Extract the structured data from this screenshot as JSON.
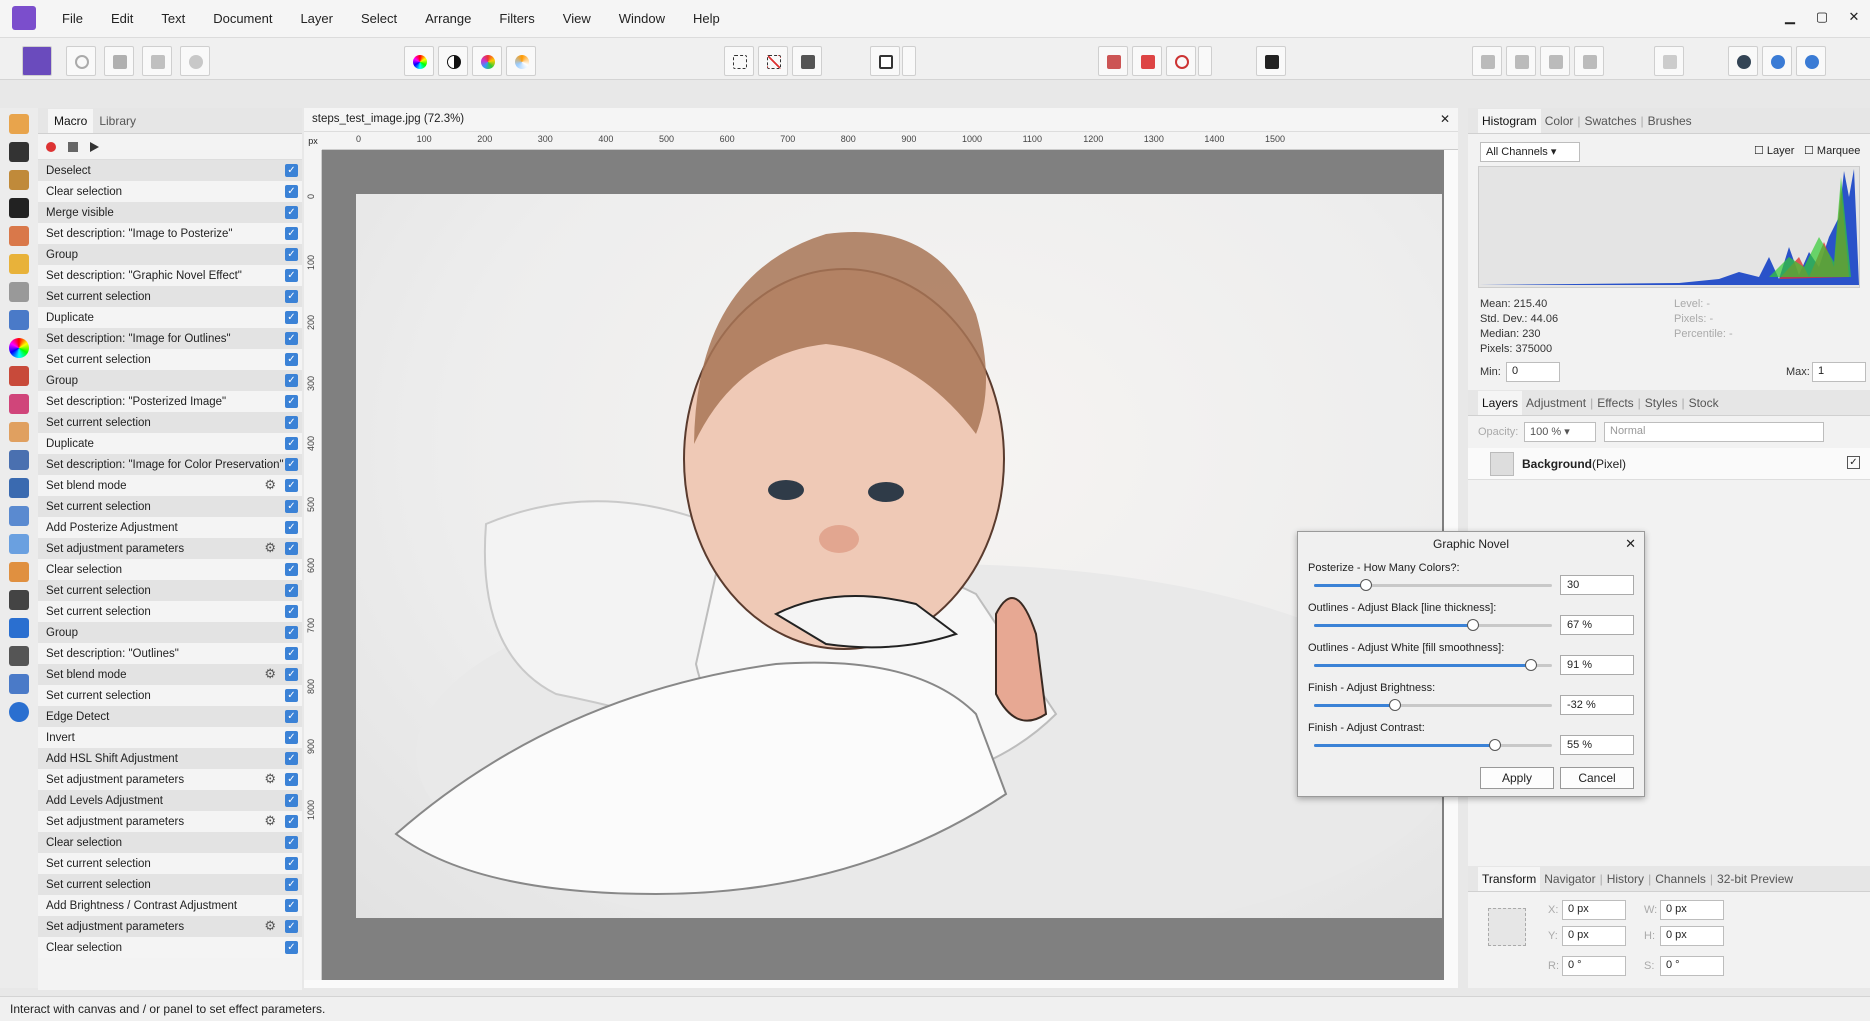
{
  "menu": [
    "File",
    "Edit",
    "Text",
    "Document",
    "Layer",
    "Select",
    "Arrange",
    "Filters",
    "View",
    "Window",
    "Help"
  ],
  "window_controls": {
    "minimize": "▁",
    "maximize": "▢",
    "close": "✕"
  },
  "macro_panel": {
    "tabs": [
      "Macro",
      "Library"
    ],
    "items": [
      {
        "label": "Deselect",
        "gear": false
      },
      {
        "label": "Clear selection",
        "gear": false
      },
      {
        "label": "Merge visible",
        "gear": false
      },
      {
        "label": "Set description: \"Image to Posterize\"",
        "gear": false
      },
      {
        "label": "Group",
        "gear": false
      },
      {
        "label": "Set description: \"Graphic Novel Effect\"",
        "gear": false
      },
      {
        "label": "Set current selection",
        "gear": false
      },
      {
        "label": "Duplicate",
        "gear": false
      },
      {
        "label": "Set description: \"Image for Outlines\"",
        "gear": false
      },
      {
        "label": "Set current selection",
        "gear": false
      },
      {
        "label": "Group",
        "gear": false
      },
      {
        "label": "Set description: \"Posterized Image\"",
        "gear": false
      },
      {
        "label": "Set current selection",
        "gear": false
      },
      {
        "label": "Duplicate",
        "gear": false
      },
      {
        "label": "Set description: \"Image for Color Preservation\"",
        "gear": false
      },
      {
        "label": "Set blend mode",
        "gear": true
      },
      {
        "label": "Set current selection",
        "gear": false
      },
      {
        "label": "Add Posterize Adjustment",
        "gear": false
      },
      {
        "label": "Set adjustment parameters",
        "gear": true
      },
      {
        "label": "Clear selection",
        "gear": false
      },
      {
        "label": "Set current selection",
        "gear": false
      },
      {
        "label": "Set current selection",
        "gear": false
      },
      {
        "label": "Group",
        "gear": false
      },
      {
        "label": "Set description: \"Outlines\"",
        "gear": false
      },
      {
        "label": "Set blend mode",
        "gear": true
      },
      {
        "label": "Set current selection",
        "gear": false
      },
      {
        "label": "Edge Detect",
        "gear": false
      },
      {
        "label": "Invert",
        "gear": false
      },
      {
        "label": "Add HSL Shift Adjustment",
        "gear": false
      },
      {
        "label": "Set adjustment parameters",
        "gear": true
      },
      {
        "label": "Add Levels Adjustment",
        "gear": false
      },
      {
        "label": "Set adjustment parameters",
        "gear": true
      },
      {
        "label": "Clear selection",
        "gear": false
      },
      {
        "label": "Set current selection",
        "gear": false
      },
      {
        "label": "Set current selection",
        "gear": false
      },
      {
        "label": "Add Brightness / Contrast Adjustment",
        "gear": false
      },
      {
        "label": "Set adjustment parameters",
        "gear": true
      },
      {
        "label": "Clear selection",
        "gear": false
      }
    ]
  },
  "document": {
    "tab_title": "steps_test_image.jpg (72.3%)",
    "close": "✕",
    "ruler_unit": "px",
    "h_ticks": [
      "0",
      "100",
      "200",
      "300",
      "400",
      "500",
      "600",
      "700",
      "800",
      "900",
      "1000",
      "1100",
      "1200",
      "1300",
      "1400",
      "1500"
    ],
    "v_ticks": [
      "0",
      "100",
      "200",
      "300",
      "400",
      "500",
      "600",
      "700",
      "800",
      "900",
      "1000"
    ]
  },
  "histogram": {
    "tabs": [
      "Histogram",
      "Color",
      "Swatches",
      "Brushes"
    ],
    "channel": "All Channels",
    "layer_label": "Layer",
    "marquee_label": "Marquee",
    "mean": "Mean: 215.40",
    "std": "Std. Dev.: 44.06",
    "median": "Median: 230",
    "pixels": "Pixels: 375000",
    "level": "Level: -",
    "pixels2": "Pixels: -",
    "percentile": "Percentile: -",
    "min_label": "Min:",
    "min": "0",
    "max_label": "Max:",
    "max": "1"
  },
  "layers": {
    "tabs": [
      "Layers",
      "Adjustment",
      "Effects",
      "Styles",
      "Stock"
    ],
    "opacity_label": "Opacity:",
    "opacity": "100 %",
    "blend": "Normal",
    "layer_name": "Background",
    "layer_type": "(Pixel)"
  },
  "transform": {
    "tabs": [
      "Transform",
      "Navigator",
      "History",
      "Channels",
      "32-bit Preview"
    ],
    "x_label": "X:",
    "x": "0 px",
    "y_label": "Y:",
    "y": "0 px",
    "w_label": "W:",
    "w": "0 px",
    "h_label": "H:",
    "h": "0 px",
    "r_label": "R:",
    "r": "0 °",
    "s_label": "S:",
    "s": "0 °"
  },
  "dialog": {
    "title": "Graphic Novel",
    "close": "✕",
    "sliders": [
      {
        "label": "Posterize - How Many Colors?:",
        "value": "30",
        "fraction": 0.22
      },
      {
        "label": "Outlines - Adjust Black [line thickness]:",
        "value": "67 %",
        "fraction": 0.67
      },
      {
        "label": "Outlines - Adjust White [fill smoothness]:",
        "value": "91 %",
        "fraction": 0.91
      },
      {
        "label": "Finish - Adjust Brightness:",
        "value": "-32 %",
        "fraction": 0.34
      },
      {
        "label": "Finish - Adjust Contrast:",
        "value": "55 %",
        "fraction": 0.76
      }
    ],
    "apply": "Apply",
    "cancel": "Cancel"
  },
  "status": "Interact with canvas and / or panel to set effect parameters."
}
